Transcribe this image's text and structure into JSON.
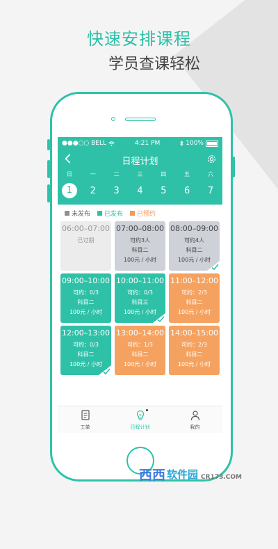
{
  "promo": {
    "headline1": "快速安排课程",
    "headline2": "学员查课轻松"
  },
  "status_bar": {
    "carrier": "●●●○○ BELL",
    "time": "4:21 PM",
    "battery": "100%"
  },
  "nav": {
    "title": "日程计划",
    "back_icon": "chevron-left-icon",
    "settings_icon": "gear-icon"
  },
  "calendar": {
    "weekdays": [
      "日",
      "一",
      "二",
      "三",
      "四",
      "五",
      "六"
    ],
    "dates": [
      "1",
      "2",
      "3",
      "4",
      "5",
      "6",
      "7"
    ],
    "selected_index": 0
  },
  "legend": [
    {
      "label": "未发布",
      "color": "#8e9096"
    },
    {
      "label": "已发布",
      "color": "#2fc1a8"
    },
    {
      "label": "已预约",
      "color": "#f29a57"
    }
  ],
  "slots": [
    {
      "time": "06:00–07:00",
      "line1": "",
      "line2": "已过期",
      "line3": "",
      "state": "expired",
      "checked": false
    },
    {
      "time": "07:00–08:00",
      "line1": "可约3人",
      "line2": "科目二",
      "line3": "100元 / 小时",
      "state": "unpub",
      "checked": false
    },
    {
      "time": "08:00–09:00",
      "line1": "可约4人",
      "line2": "科目二",
      "line3": "100元 / 小时",
      "state": "unpub",
      "checked": true
    },
    {
      "time": "09:00–10:00",
      "line1": "可约：0/3",
      "line2": "科目二",
      "line3": "100元 / 小时",
      "state": "pub",
      "checked": false
    },
    {
      "time": "10:00–11:00",
      "line1": "可约：0/3",
      "line2": "科目三",
      "line3": "100元 / 小时",
      "state": "pub",
      "checked": true
    },
    {
      "time": "11:00–12:00",
      "line1": "可约：2/3",
      "line2": "科目二",
      "line3": "100元 / 小时",
      "state": "book",
      "checked": false
    },
    {
      "time": "12:00–13:00",
      "line1": "可约：0/3",
      "line2": "科目二",
      "line3": "100元 / 小时",
      "state": "pub",
      "checked": true
    },
    {
      "time": "13:00–14:00",
      "line1": "可约：1/3",
      "line2": "科目二",
      "line3": "100元 / 小时",
      "state": "book",
      "checked": false
    },
    {
      "time": "14:00–15:00",
      "line1": "可约：2/3",
      "line2": "科目二",
      "line3": "100元 / 小时",
      "state": "book",
      "checked": false
    }
  ],
  "tabs": [
    {
      "label": "工单",
      "icon": "document-icon",
      "active": false
    },
    {
      "label": "日程计划",
      "icon": "lightbulb-icon",
      "active": true
    },
    {
      "label": "我的",
      "icon": "person-icon",
      "active": false
    }
  ],
  "watermark": {
    "brand": "西西",
    "sub": "软件园",
    "url": "CR173.COM"
  }
}
